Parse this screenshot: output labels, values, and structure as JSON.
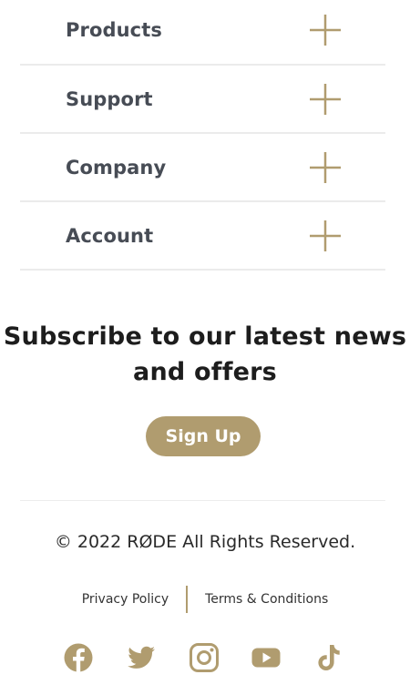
{
  "footer_nav": {
    "items": [
      {
        "label": "Products"
      },
      {
        "label": "Support"
      },
      {
        "label": "Company"
      },
      {
        "label": "Account"
      }
    ]
  },
  "subscribe": {
    "line1": "Subscribe to our latest news",
    "line2": "and offers",
    "button_label": "Sign Up"
  },
  "copyright": "© 2022 RØDE All Rights Reserved.",
  "legal": {
    "privacy": "Privacy Policy",
    "terms": "Terms & Conditions"
  },
  "social": [
    "facebook-icon",
    "twitter-icon",
    "instagram-icon",
    "youtube-icon",
    "tiktok-icon"
  ],
  "colors": {
    "accent": "#b09c6f",
    "heading": "#1d1d1d",
    "nav_text": "#474c55"
  }
}
